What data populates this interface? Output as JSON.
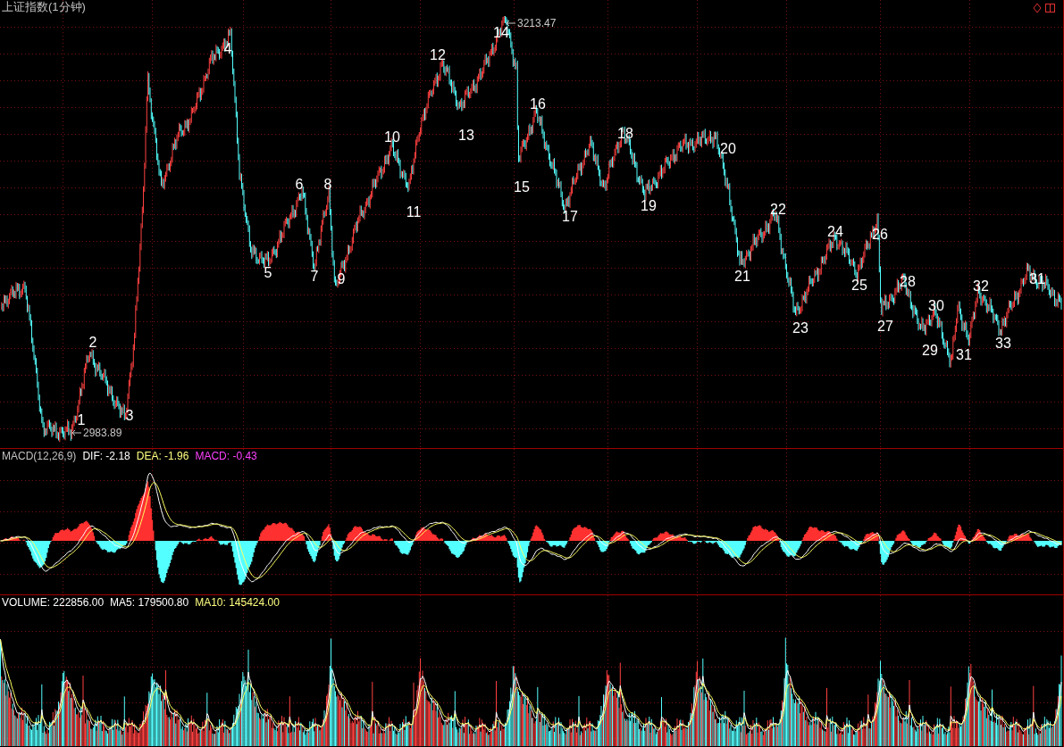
{
  "chart": {
    "title": "上证指数(1分钟)",
    "extremes": [
      {
        "kind": "low",
        "value": "2983.89"
      },
      {
        "kind": "high",
        "value": "3213.47"
      }
    ],
    "wave_labels": [
      "1",
      "2",
      "3",
      "4",
      "5",
      "6",
      "7",
      "8",
      "9",
      "10",
      "11",
      "12",
      "13",
      "14",
      "15",
      "16",
      "17",
      "18",
      "19",
      "20",
      "21",
      "22",
      "23",
      "24",
      "25",
      "26",
      "27",
      "28",
      "29",
      "30",
      "31",
      "32",
      "33",
      "31"
    ]
  },
  "macd_panel": {
    "indicators": [
      {
        "text": "MACD(12,26,9)",
        "color": "#c0c0c0"
      },
      {
        "text": "DIF: -2.18",
        "color": "#ffffff"
      },
      {
        "text": "DEA: -1.96",
        "color": "#ffff80"
      },
      {
        "text": "MACD: -0.43",
        "color": "#ff40ff"
      }
    ]
  },
  "volume_panel": {
    "indicators": [
      {
        "text": "VOLUME: 222856.00",
        "color": "#ffffff"
      },
      {
        "text": "MA5: 179500.80",
        "color": "#ffffff"
      },
      {
        "text": "MA10: 145424.00",
        "color": "#ffff80"
      }
    ]
  }
}
